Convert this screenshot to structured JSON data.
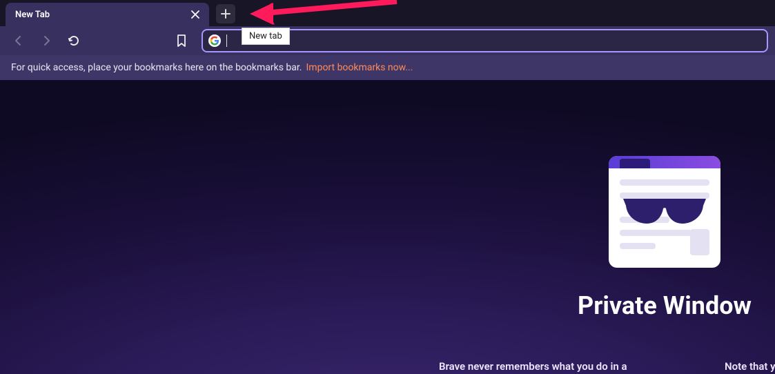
{
  "tabs": {
    "active": {
      "title": "New Tab"
    },
    "new_tab_tooltip": "New tab"
  },
  "toolbar": {
    "address_value": ""
  },
  "bookmark_bar": {
    "hint": "For quick access, place your bookmarks here on the bookmarks bar.",
    "import_link": "Import bookmarks now..."
  },
  "content": {
    "heading": "Private Window",
    "sub1": "Brave never remembers what you do in a",
    "sub2": "Note that yo"
  }
}
